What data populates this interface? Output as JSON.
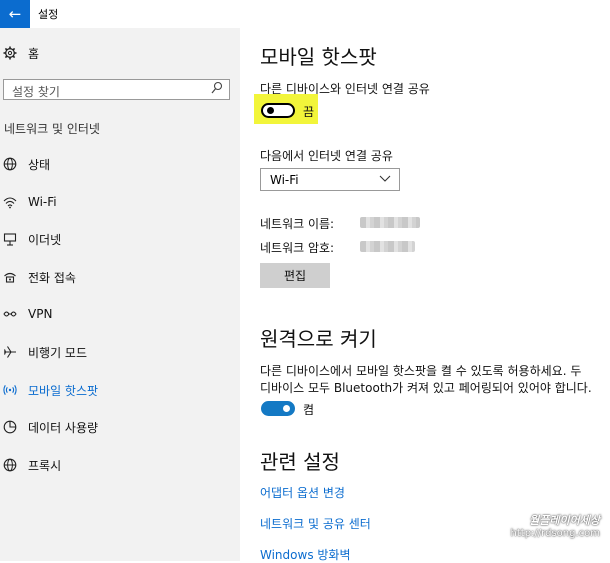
{
  "window": {
    "title": "설정",
    "back_icon": "arrow-left-icon",
    "accent": "#0b6ccf"
  },
  "sidebar": {
    "home": {
      "label": "홈",
      "icon": "gear-icon"
    },
    "search": {
      "placeholder": "설정 찾기",
      "icon": "search-icon"
    },
    "section_title": "네트워크 및 인터넷",
    "items": [
      {
        "label": "상태",
        "icon": "globe-icon",
        "active": false
      },
      {
        "label": "Wi-Fi",
        "icon": "wifi-icon",
        "active": false
      },
      {
        "label": "이더넷",
        "icon": "ethernet-icon",
        "active": false
      },
      {
        "label": "전화 접속",
        "icon": "dialup-icon",
        "active": false
      },
      {
        "label": "VPN",
        "icon": "vpn-icon",
        "active": false
      },
      {
        "label": "비행기 모드",
        "icon": "airplane-icon",
        "active": false
      },
      {
        "label": "모바일 핫스팟",
        "icon": "hotspot-icon",
        "active": true
      },
      {
        "label": "데이터 사용량",
        "icon": "data-usage-icon",
        "active": false
      },
      {
        "label": "프록시",
        "icon": "globe-icon",
        "active": false
      }
    ]
  },
  "main": {
    "title": "모바일 핫스팟",
    "share": {
      "label": "다른 디바이스와 인터넷 연결 공유",
      "toggle_state": "끔",
      "highlight_color": "#f2f53a"
    },
    "share_from": {
      "label": "다음에서 인터넷 연결 공유",
      "value": "Wi-Fi"
    },
    "network_name_label": "네트워크 이름:",
    "network_password_label": "네트워크 암호:",
    "edit_button": "편집",
    "remote": {
      "title": "원격으로 켜기",
      "desc_line1": "다른 디바이스에서 모바일 핫스팟을 켤 수 있도록 허용하세요. 두",
      "desc_line2": "디바이스 모두 Bluetooth가 켜져 있고 페어링되어 있어야 합니다.",
      "toggle_state": "켬"
    },
    "related": {
      "title": "관련 설정",
      "links": [
        "어댑터 옵션 변경",
        "네트워크 및 공유 센터",
        "Windows 방화벽"
      ]
    }
  },
  "watermark": {
    "title": "월플레이어세상",
    "url": "http://rdsong.com"
  }
}
